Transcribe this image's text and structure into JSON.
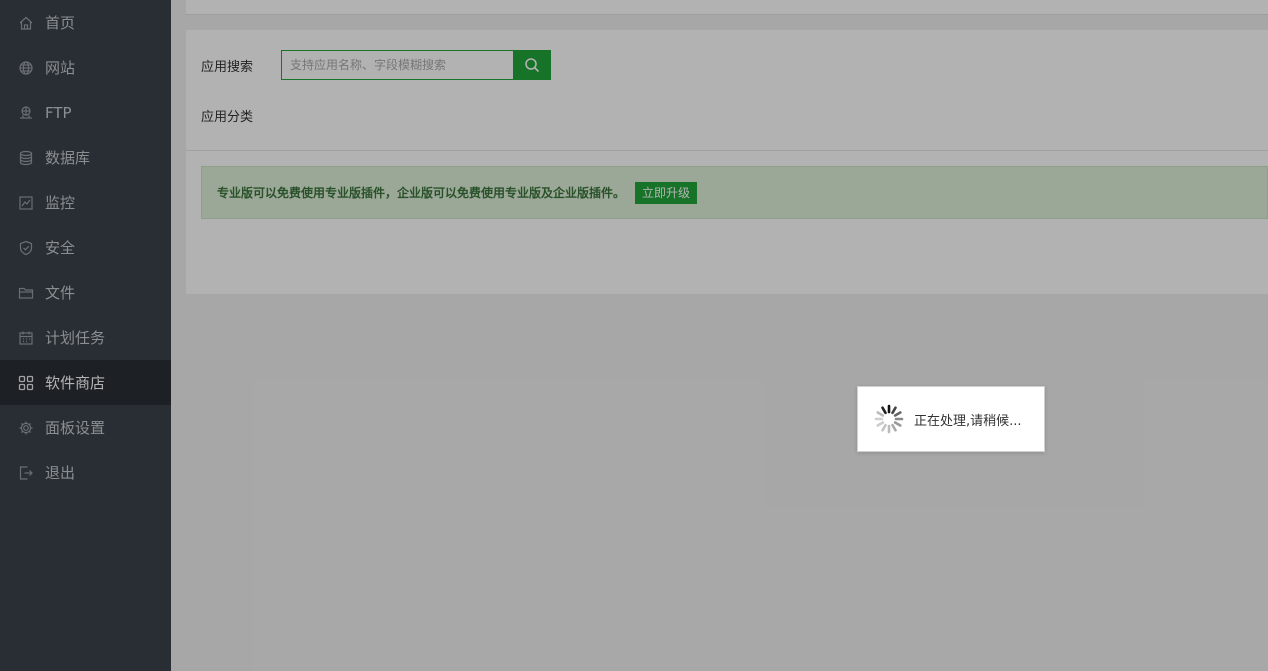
{
  "sidebar": {
    "items": [
      {
        "label": "首页",
        "icon": "home-icon"
      },
      {
        "label": "网站",
        "icon": "globe-icon"
      },
      {
        "label": "FTP",
        "icon": "ftp-icon"
      },
      {
        "label": "数据库",
        "icon": "database-icon"
      },
      {
        "label": "监控",
        "icon": "monitor-icon"
      },
      {
        "label": "安全",
        "icon": "shield-icon"
      },
      {
        "label": "文件",
        "icon": "folder-icon"
      },
      {
        "label": "计划任务",
        "icon": "calendar-icon"
      },
      {
        "label": "软件商店",
        "icon": "grid-icon",
        "active": true
      },
      {
        "label": "面板设置",
        "icon": "gear-icon"
      },
      {
        "label": "退出",
        "icon": "logout-icon"
      }
    ]
  },
  "search": {
    "label": "应用搜索",
    "placeholder": "支持应用名称、字段模糊搜索",
    "button_icon": "search-icon"
  },
  "category": {
    "label": "应用分类"
  },
  "notice": {
    "text": "专业版可以免费使用专业版插件，企业版可以免费使用专业版及企业版插件。",
    "button_label": "立即升级"
  },
  "loading": {
    "text": "正在处理,请稍候..."
  },
  "colors": {
    "sidebar_bg": "#3a424a",
    "sidebar_active_bg": "#2a2f35",
    "accent": "#20a53a",
    "notice_bg": "#dff0d8",
    "notice_text": "#3c763d"
  }
}
